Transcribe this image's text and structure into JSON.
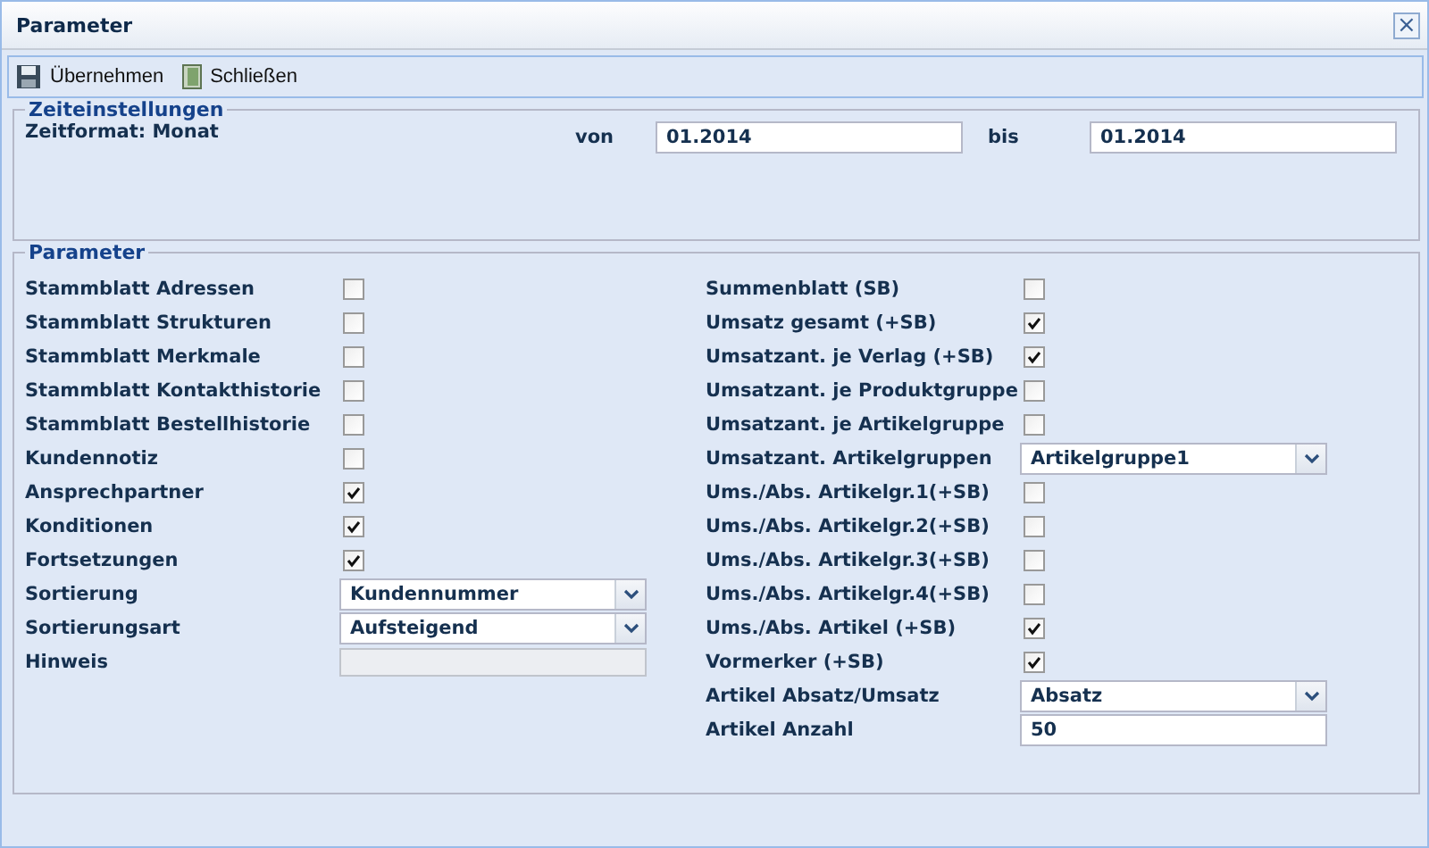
{
  "window": {
    "title": "Parameter",
    "close": "×"
  },
  "toolbar": [
    {
      "kind": "save",
      "label": "Übernehmen"
    },
    {
      "kind": "close",
      "label": "Schließen"
    }
  ],
  "time_settings": {
    "legend": "Zeiteinstellungen",
    "format": "Zeitformat: Monat",
    "from_label": "von",
    "from": "01.2014",
    "to_label": "bis",
    "to": "01.2014"
  },
  "parameters": {
    "legend": "Parameter",
    "left": [
      {
        "kind": "checkbox",
        "label": "Stammblatt Adressen",
        "checked": false
      },
      {
        "kind": "checkbox",
        "label": "Stammblatt Strukturen",
        "checked": false
      },
      {
        "kind": "checkbox",
        "label": "Stammblatt Merkmale",
        "checked": false
      },
      {
        "kind": "checkbox",
        "label": "Stammblatt Kontakthistorie",
        "checked": false
      },
      {
        "kind": "checkbox",
        "label": "Stammblatt Bestellhistorie",
        "checked": false
      },
      {
        "kind": "checkbox",
        "label": "Kundennotiz",
        "checked": false
      },
      {
        "kind": "checkbox",
        "label": "Ansprechpartner",
        "checked": true
      },
      {
        "kind": "checkbox",
        "label": "Konditionen",
        "checked": true
      },
      {
        "kind": "checkbox",
        "label": "Fortsetzungen",
        "checked": true
      },
      {
        "kind": "select",
        "label": "Sortierung",
        "value": "Kundennummer"
      },
      {
        "kind": "select",
        "label": "Sortierungsart",
        "value": "Aufsteigend"
      },
      {
        "kind": "textarea",
        "label": "Hinweis",
        "disabled": true
      }
    ],
    "right": [
      {
        "kind": "checkbox",
        "label": "Summenblatt (SB)",
        "checked": false
      },
      {
        "kind": "checkbox",
        "label": "Umsatz gesamt (+SB)",
        "checked": true
      },
      {
        "kind": "checkbox",
        "label": "Umsatzant. je Verlag (+SB)",
        "checked": true
      },
      {
        "kind": "checkbox",
        "label": "Umsatzant. je Produktgruppe",
        "checked": false
      },
      {
        "kind": "checkbox",
        "label": "Umsatzant. je Artikelgruppe",
        "checked": false
      },
      {
        "kind": "select",
        "label": "Umsatzant. Artikelgruppen",
        "value": "Artikelgruppe1"
      },
      {
        "kind": "checkbox",
        "label": "Ums./Abs. Artikelgr.1(+SB)",
        "checked": false
      },
      {
        "kind": "checkbox",
        "label": "Ums./Abs. Artikelgr.2(+SB)",
        "checked": false
      },
      {
        "kind": "checkbox",
        "label": "Ums./Abs. Artikelgr.3(+SB)",
        "checked": false
      },
      {
        "kind": "checkbox",
        "label": "Ums./Abs. Artikelgr.4(+SB)",
        "checked": false
      },
      {
        "kind": "checkbox",
        "label": "Ums./Abs. Artikel (+SB)",
        "checked": true
      },
      {
        "kind": "checkbox",
        "label": "Vormerker (+SB)",
        "checked": true
      },
      {
        "kind": "select",
        "label": "Artikel Absatz/Umsatz",
        "value": "Absatz"
      },
      {
        "kind": "input",
        "label": "Artikel Anzahl",
        "value": "50"
      }
    ]
  }
}
